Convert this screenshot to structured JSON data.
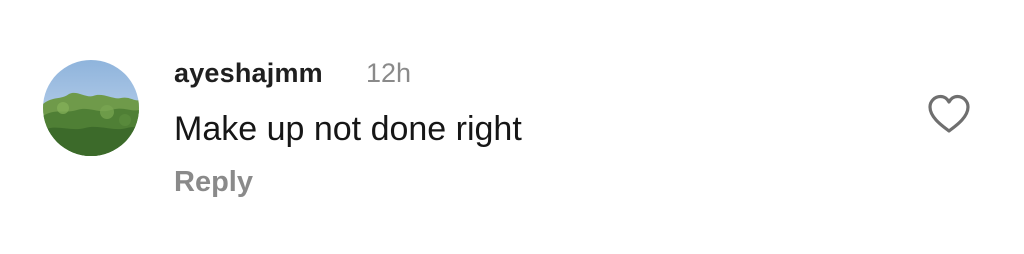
{
  "comment": {
    "username": "ayeshajmm",
    "timestamp": "12h",
    "text": "Make up not done right",
    "reply_label": "Reply"
  },
  "icons": {
    "avatar": "avatar-photo-trees",
    "like": "heart-outline-icon"
  },
  "colors": {
    "username": "#1f1f1f",
    "meta": "#8a8a8a",
    "text": "#161616",
    "icon_stroke": "#6f6f6f"
  }
}
